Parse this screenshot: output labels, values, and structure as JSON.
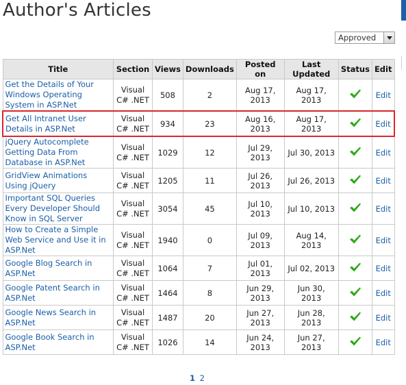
{
  "page": {
    "title": "Author's Articles"
  },
  "filter": {
    "selected": "Approved"
  },
  "table": {
    "headers": {
      "title": "Title",
      "section": "Section",
      "views": "Views",
      "downloads": "Downloads",
      "posted_on": "Posted on",
      "last_updated": "Last Updated",
      "status": "Status",
      "edit": "Edit"
    },
    "rows": [
      {
        "title": "Get the Details of Your Windows Operating System in ASP.Net",
        "section": "Visual C# .NET",
        "views": "508",
        "downloads": "2",
        "posted_on": "Aug 17, 2013",
        "last_updated": "Aug 17, 2013",
        "status": "approved",
        "edit": "Edit"
      },
      {
        "title": "Get All Intranet User Details in ASP.Net",
        "section": "Visual C# .NET",
        "views": "934",
        "downloads": "23",
        "posted_on": "Aug 16, 2013",
        "last_updated": "Aug 17, 2013",
        "status": "approved",
        "edit": "Edit"
      },
      {
        "title": "jQuery Autocomplete Getting Data From Database in ASP.Net",
        "section": "Visual C# .NET",
        "views": "1029",
        "downloads": "12",
        "posted_on": "Jul 29, 2013",
        "last_updated": "Jul 30, 2013",
        "status": "approved",
        "edit": "Edit"
      },
      {
        "title": "GridView Animations Using jQuery",
        "section": "Visual C# .NET",
        "views": "1205",
        "downloads": "11",
        "posted_on": "Jul 26, 2013",
        "last_updated": "Jul 26, 2013",
        "status": "approved",
        "edit": "Edit"
      },
      {
        "title": "Important SQL Queries Every Developer Should Know in SQL Server",
        "section": "Visual C# .NET",
        "views": "3054",
        "downloads": "45",
        "posted_on": "Jul 10, 2013",
        "last_updated": "Jul 10, 2013",
        "status": "approved",
        "edit": "Edit"
      },
      {
        "title": "How to Create a Simple Web Service and Use it in ASP.Net",
        "section": "Visual C# .NET",
        "views": "1940",
        "downloads": "0",
        "posted_on": "Jul 09, 2013",
        "last_updated": "Aug 14, 2013",
        "status": "approved",
        "edit": "Edit"
      },
      {
        "title": "Google Blog Search in ASP.Net",
        "section": "Visual C# .NET",
        "views": "1064",
        "downloads": "7",
        "posted_on": "Jul 01, 2013",
        "last_updated": "Jul 02, 2013",
        "status": "approved",
        "edit": "Edit"
      },
      {
        "title": "Google Patent Search in ASP.Net",
        "section": "Visual C# .NET",
        "views": "1464",
        "downloads": "8",
        "posted_on": "Jun 29, 2013",
        "last_updated": "Jun 30, 2013",
        "status": "approved",
        "edit": "Edit"
      },
      {
        "title": "Google News Search in ASP.Net",
        "section": "Visual C# .NET",
        "views": "1487",
        "downloads": "20",
        "posted_on": "Jun 27, 2013",
        "last_updated": "Jun 28, 2013",
        "status": "approved",
        "edit": "Edit"
      },
      {
        "title": "Google Book Search in ASP.Net",
        "section": "Visual C# .NET",
        "views": "1026",
        "downloads": "14",
        "posted_on": "Jun 24, 2013",
        "last_updated": "Jun 27, 2013",
        "status": "approved",
        "edit": "Edit"
      }
    ],
    "highlighted_row": 1
  },
  "pager": {
    "current": "1",
    "pages": [
      "2"
    ]
  },
  "colors": {
    "link": "#1a5ea8",
    "highlight_border": "#d9262c",
    "check": "#2fa81a",
    "header_bg": "#e6e6e6",
    "accent": "#1f5fa6"
  },
  "icons": {
    "status": "checkmark-icon"
  }
}
